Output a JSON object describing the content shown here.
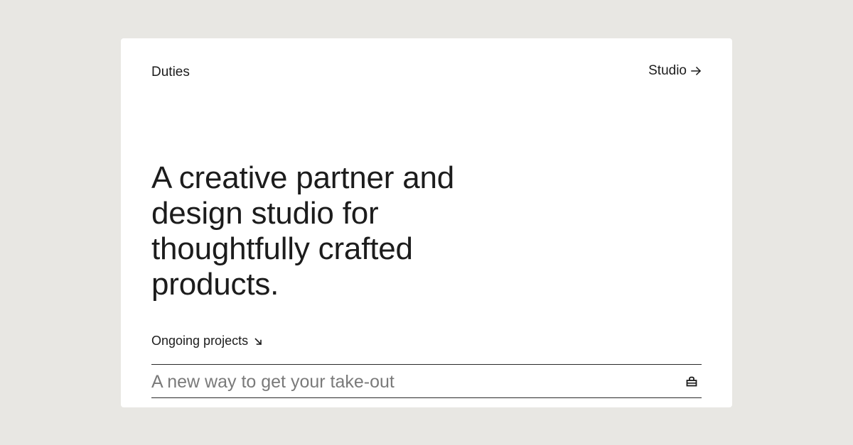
{
  "header": {
    "brand": "Duties",
    "studio_link": "Studio",
    "studio_icon": "arrow-right-icon"
  },
  "hero": {
    "headline": "A creative partner and design studio for thoughtfully crafted products."
  },
  "projects": {
    "label": "Ongoing projects",
    "label_icon": "arrow-down-right-icon",
    "items": [
      {
        "title": "A new way to get your take-out",
        "icon": "lock-icon"
      }
    ]
  },
  "colors": {
    "page_background": "#e8e7e3",
    "card_background": "#ffffff",
    "text": "#1c1c1c",
    "muted_text": "#7a7a7a"
  }
}
